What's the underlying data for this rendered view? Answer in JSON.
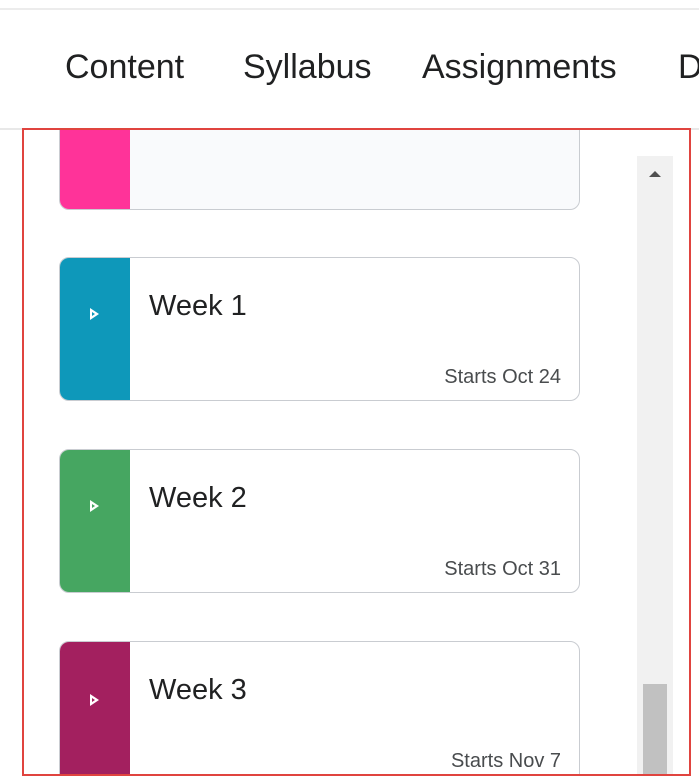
{
  "nav": {
    "items": [
      {
        "label": "Content"
      },
      {
        "label": "Syllabus"
      },
      {
        "label": "Assignments"
      },
      {
        "label": "D"
      }
    ]
  },
  "modules": [
    {
      "title": "",
      "starts": "",
      "color": "#ff3399",
      "partial": true
    },
    {
      "title": "Week 1",
      "starts": "Starts Oct 24",
      "color": "#0e98ba"
    },
    {
      "title": "Week 2",
      "starts": "Starts Oct 31",
      "color": "#46a661"
    },
    {
      "title": "Week 3",
      "starts": "Starts Nov 7",
      "color": "#a3205f"
    }
  ],
  "colors": {
    "highlight_border": "#e0443f",
    "scroll_thumb": "#c1c1c1"
  },
  "icons": {
    "module_expand": "caret-right-icon",
    "scroll_up": "triangle-up-icon"
  }
}
